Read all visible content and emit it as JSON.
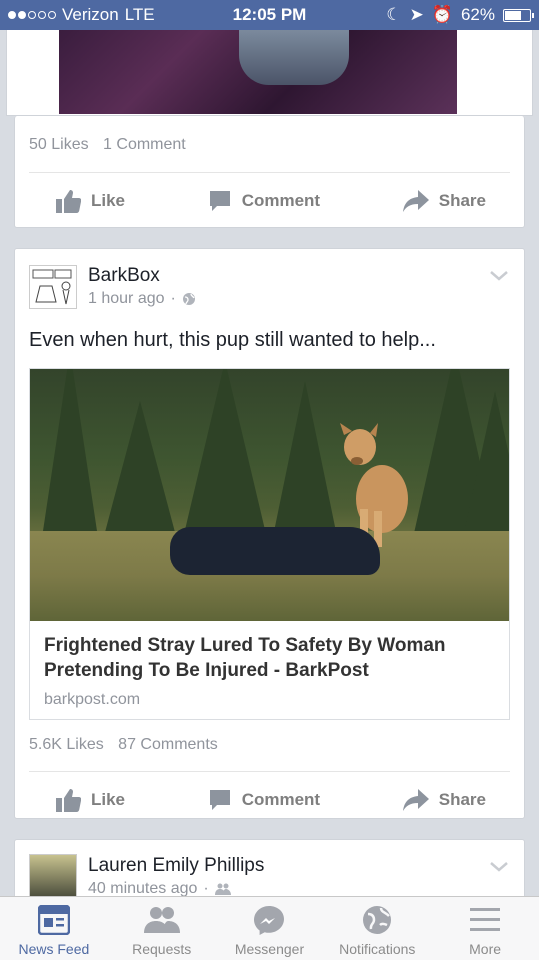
{
  "status_bar": {
    "carrier": "Verizon",
    "network": "LTE",
    "time": "12:05 PM",
    "battery": "62%",
    "battery_level": 0.62
  },
  "top_post": {
    "likes": "50 Likes",
    "comments": "1 Comment"
  },
  "actions": {
    "like": "Like",
    "comment": "Comment",
    "share": "Share"
  },
  "post": {
    "author": "BarkBox",
    "time": "1 hour ago",
    "text": "Even when hurt, this pup still wanted to help...",
    "link_title": "Frightened Stray Lured To Safety By Woman Pretending To Be Injured - BarkPost",
    "link_domain": "barkpost.com",
    "likes": "5.6K Likes",
    "comments": "87 Comments"
  },
  "next_post": {
    "author": "Lauren Emily Phillips",
    "time": "40 minutes ago"
  },
  "tabs": [
    {
      "label": "News Feed",
      "icon": "news-feed-icon",
      "active": true
    },
    {
      "label": "Requests",
      "icon": "friend-requests-icon"
    },
    {
      "label": "Messenger",
      "icon": "messenger-icon"
    },
    {
      "label": "Notifications",
      "icon": "globe-icon"
    },
    {
      "label": "More",
      "icon": "menu-icon"
    }
  ],
  "colors": {
    "brand": "#4e69a2",
    "background": "#d8dce2",
    "muted": "#90949c"
  }
}
